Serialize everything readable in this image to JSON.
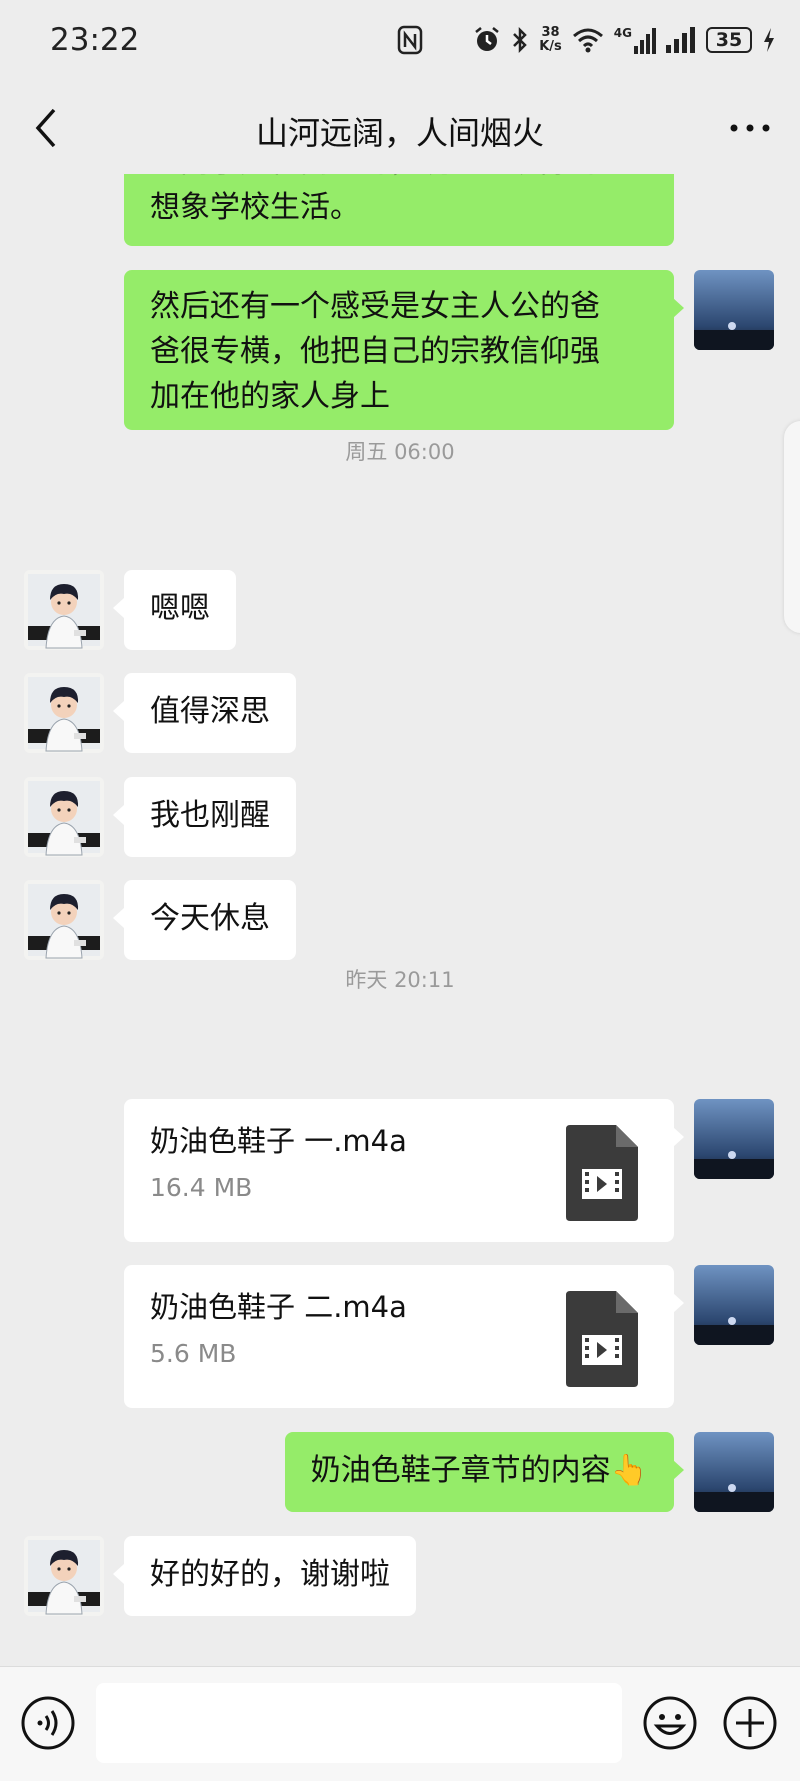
{
  "status_bar": {
    "time": "23:22",
    "net_speed_value": "38",
    "net_speed_unit": "K/s",
    "network_type": "4G",
    "battery_level": "35",
    "icons": [
      "nfc-icon",
      "alarm-icon",
      "bluetooth-icon",
      "wifi-icon",
      "cellular-icon",
      "battery-icon",
      "charging-icon"
    ]
  },
  "header": {
    "title": "山河远阔，人间烟火",
    "icons": [
      "back-icon",
      "more-icon"
    ]
  },
  "messages": {
    "msg1": {
      "line1": "盘问了是在高里的，说一些现际的",
      "line2": "想象学校生活。"
    },
    "msg2": {
      "line1": "然后还有一个感受是女主人公的爸",
      "line2": "爸很专横，他把自己的宗教信仰强",
      "line3": "加在他的家人身上"
    },
    "time1": "周五 06:00",
    "msg3": "嗯嗯",
    "msg4": "值得深思",
    "msg5": "我也刚醒",
    "msg6": "今天休息",
    "time2": "昨天 20:11",
    "file1": {
      "name": "奶油色鞋子 一.m4a",
      "size": "16.4 MB"
    },
    "file2": {
      "name": "奶油色鞋子 二.m4a",
      "size": "5.6 MB"
    },
    "msg7": "奶油色鞋子章节的内容👆",
    "msg8": "好的好的，谢谢啦"
  },
  "input_bar": {
    "icons": [
      "voice-icon",
      "emoji-icon",
      "plus-icon"
    ],
    "text_value": ""
  },
  "colors": {
    "background": "#ededed",
    "sent_bubble": "#95ec69",
    "received_bubble": "#ffffff",
    "time_label": "#9a9a9a",
    "file_icon": "#3b3b3b"
  }
}
